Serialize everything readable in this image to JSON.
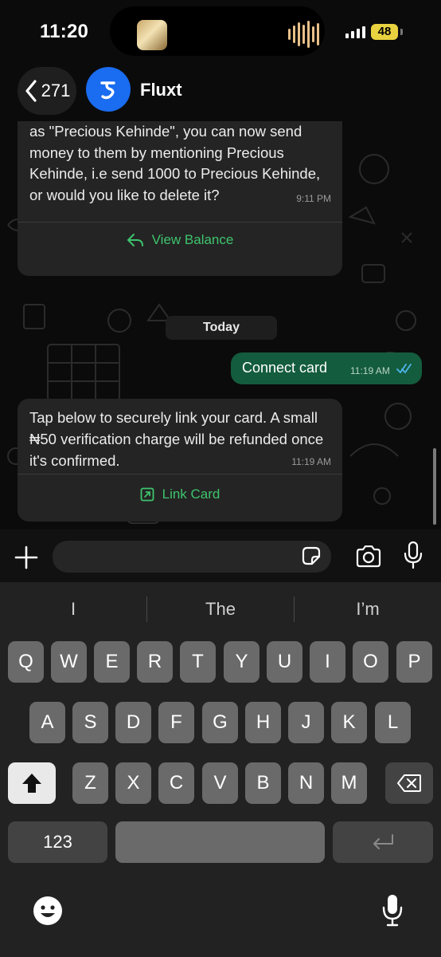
{
  "status": {
    "time": "11:20",
    "battery": "48"
  },
  "header": {
    "back_count": "271",
    "contact_name": "Fluxt"
  },
  "messages": {
    "msg1_text": "as \"Precious Kehinde\", you can now send money to them by mentioning Precious Kehinde, i.e send 1000 to Precious Kehinde, or would you like to delete it?",
    "msg1_time": "9:11 PM",
    "msg1_button": "View Balance",
    "date_divider": "Today",
    "out_text": "Connect card",
    "out_time": "11:19 AM",
    "msg2_text": "Tap below to securely link your card. A small ₦50 verification charge will be refunded once it's confirmed.",
    "msg2_time": "11:19 AM",
    "msg2_button": "Link Card"
  },
  "composer": {
    "placeholder": ""
  },
  "keyboard": {
    "suggestions": [
      "I",
      "The",
      "I’m"
    ],
    "row1": [
      "Q",
      "W",
      "E",
      "R",
      "T",
      "Y",
      "U",
      "I",
      "O",
      "P"
    ],
    "row2": [
      "A",
      "S",
      "D",
      "F",
      "G",
      "H",
      "J",
      "K",
      "L"
    ],
    "row3": [
      "Z",
      "X",
      "C",
      "V",
      "B",
      "N",
      "M"
    ],
    "numbers_key": "123"
  },
  "colors": {
    "accent_green": "#3ec46d",
    "outgoing_bubble": "#145c3e",
    "avatar_blue": "#1a6cf0",
    "read_check": "#4fb6ec"
  },
  "icons": [
    "back-chevron-icon",
    "fluxt-logo-icon",
    "reply-icon",
    "external-link-icon",
    "double-check-icon",
    "plus-icon",
    "sticker-icon",
    "camera-icon",
    "mic-icon",
    "shift-icon",
    "backspace-icon",
    "return-icon",
    "emoji-icon",
    "dictation-mic-icon"
  ]
}
